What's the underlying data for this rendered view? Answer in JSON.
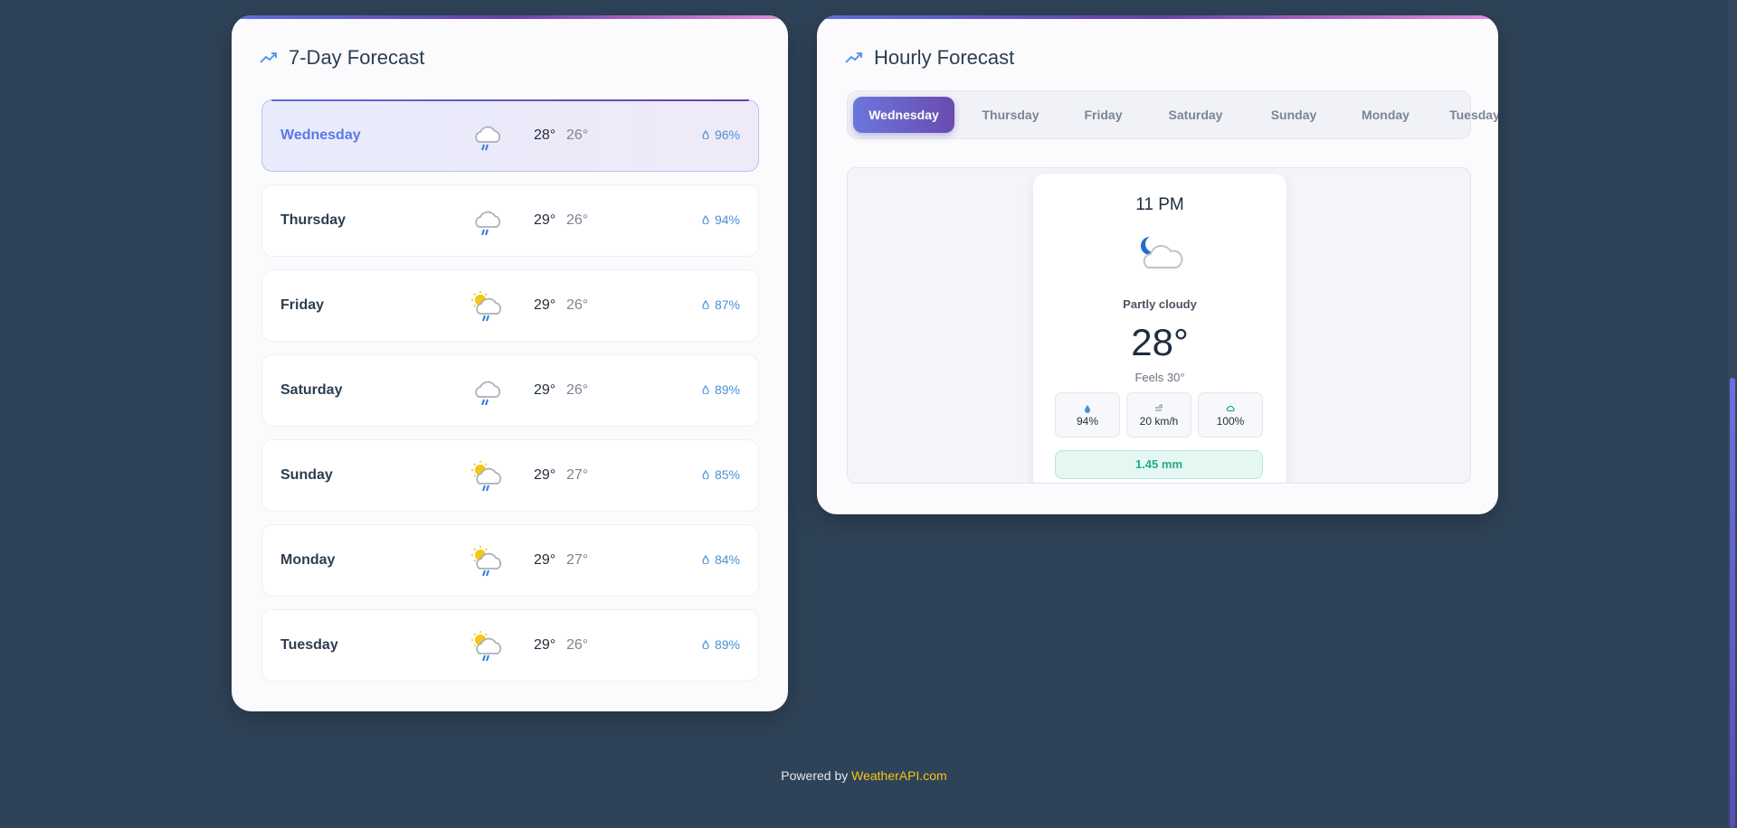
{
  "daily": {
    "title": "7-Day Forecast",
    "days": [
      {
        "name": "Wednesday",
        "high": "28°",
        "low": "26°",
        "rain": "96%",
        "icon": "rain-cloud-icon"
      },
      {
        "name": "Thursday",
        "high": "29°",
        "low": "26°",
        "rain": "94%",
        "icon": "rain-cloud-icon"
      },
      {
        "name": "Friday",
        "high": "29°",
        "low": "26°",
        "rain": "87%",
        "icon": "sun-rain-cloud-icon"
      },
      {
        "name": "Saturday",
        "high": "29°",
        "low": "26°",
        "rain": "89%",
        "icon": "rain-cloud-icon"
      },
      {
        "name": "Sunday",
        "high": "29°",
        "low": "27°",
        "rain": "85%",
        "icon": "sun-rain-cloud-icon"
      },
      {
        "name": "Monday",
        "high": "29°",
        "low": "27°",
        "rain": "84%",
        "icon": "sun-rain-cloud-icon"
      },
      {
        "name": "Tuesday",
        "high": "29°",
        "low": "26°",
        "rain": "89%",
        "icon": "sun-rain-cloud-icon"
      }
    ]
  },
  "hourly": {
    "title": "Hourly Forecast",
    "tabs": [
      "Wednesday",
      "Thursday",
      "Friday",
      "Saturday",
      "Sunday",
      "Monday",
      "Tuesday"
    ],
    "active_tab": "Wednesday",
    "card": {
      "time": "11 PM",
      "icon": "moon-cloud-icon",
      "condition": "Partly cloudy",
      "temp": "28°",
      "feels": "Feels 30°",
      "humidity": "94%",
      "wind": "20 km/h",
      "cloud": "100%",
      "precip": "1.45 mm"
    }
  },
  "footer": {
    "prefix": "Powered by ",
    "brand": "WeatherAPI.com"
  },
  "colors": {
    "background": "#2f4358",
    "accent": "#5b6ee1",
    "rain": "#4a90d9",
    "brand": "#f5c518",
    "precip": "#1fae87"
  }
}
